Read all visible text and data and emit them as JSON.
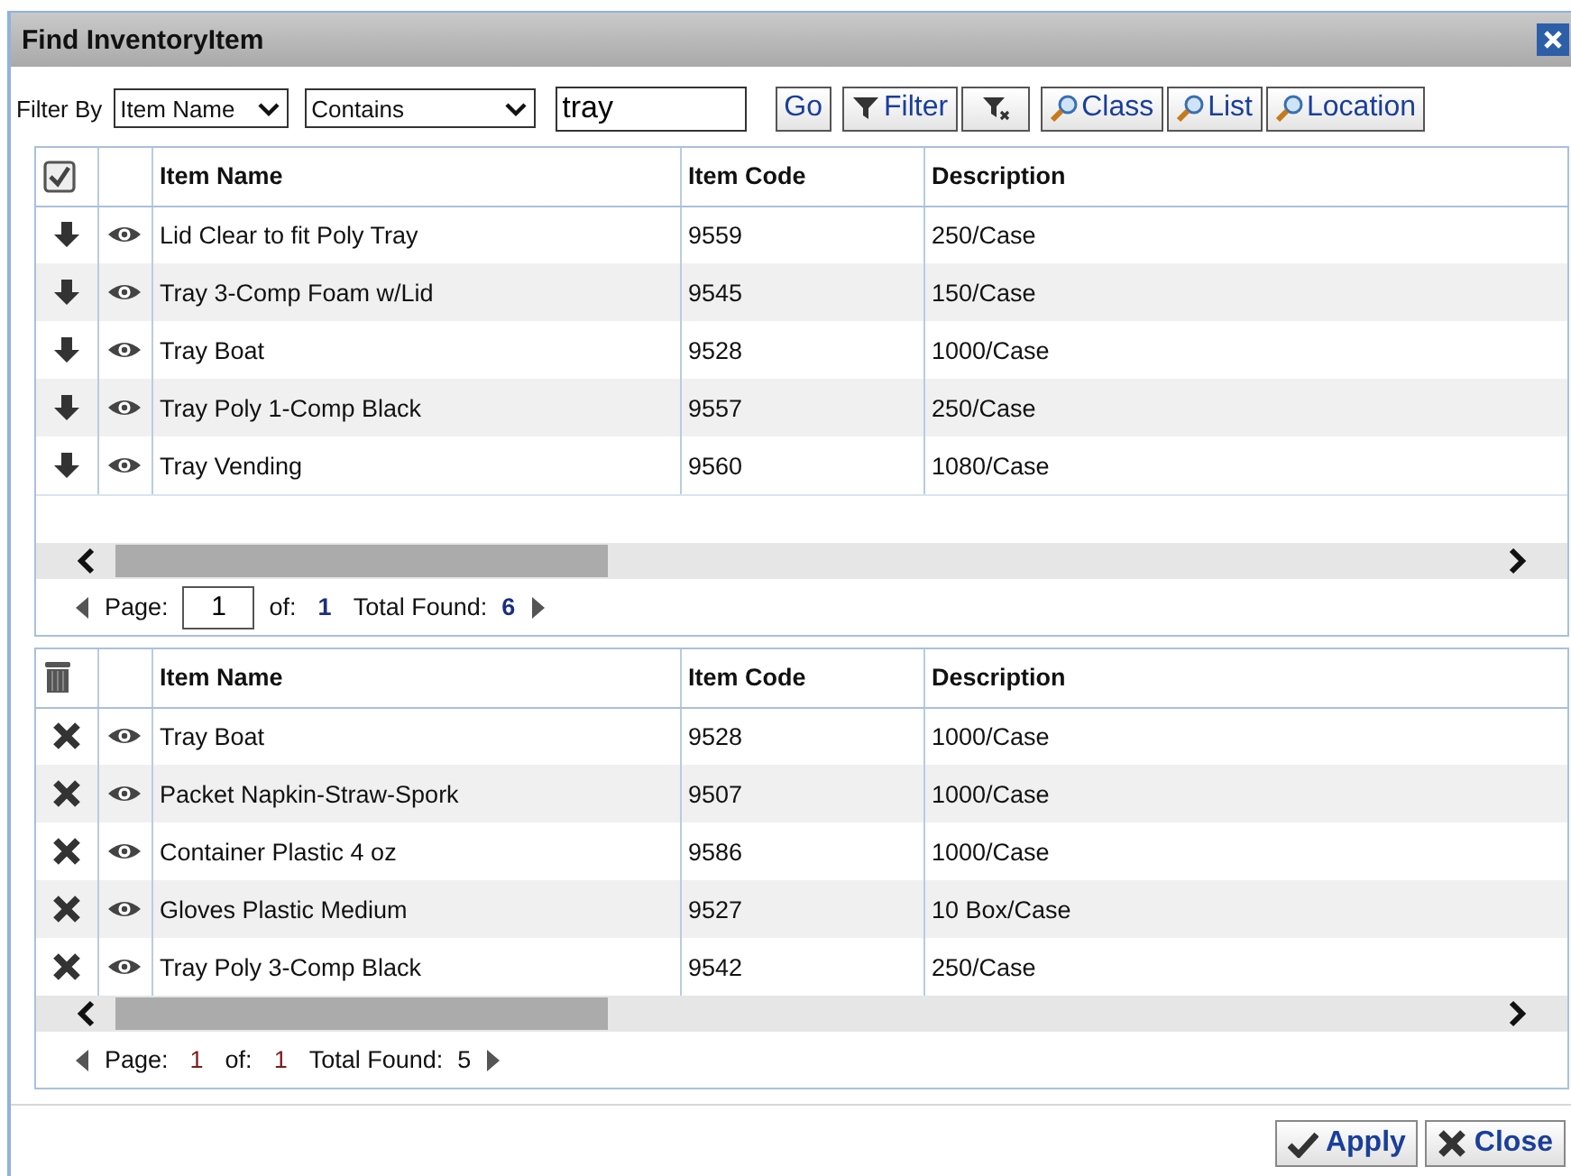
{
  "window": {
    "title": "Find InventoryItem"
  },
  "filter_bar": {
    "label": "Filter By",
    "field_select": "Item Name",
    "operator_select": "Contains",
    "search": {
      "value": "tray"
    },
    "buttons": [
      {
        "label": "Go",
        "kind": "plain"
      },
      {
        "label": "Filter",
        "kind": "filter"
      },
      {
        "kind": "clear"
      },
      {
        "label": "Class",
        "kind": "lookup"
      },
      {
        "label": "List",
        "kind": "lookup"
      },
      {
        "label": "Location",
        "kind": "lookup"
      }
    ]
  },
  "results": {
    "header_checkbox": {
      "checked": true
    },
    "columns": [
      "Item Name",
      "Item Code",
      "Description"
    ],
    "rows": [
      {
        "cells": [
          "Lid Clear to fit Poly Tray",
          "9559",
          "250/Case"
        ]
      },
      {
        "cells": [
          "Tray 3-Comp Foam w/Lid",
          "9545",
          "150/Case"
        ]
      },
      {
        "cells": [
          "Tray Boat",
          "9528",
          "1000/Case"
        ]
      },
      {
        "cells": [
          "Tray Poly 1-Comp Black",
          "9557",
          "250/Case"
        ]
      },
      {
        "cells": [
          "Tray Vending",
          "9560",
          "1080/Case"
        ]
      }
    ],
    "pager": {
      "page_label": "Page:",
      "page": "1",
      "page_editable": true,
      "of_label": "of:",
      "pages": "1",
      "total_label": "Total Found:",
      "total": "6"
    }
  },
  "selected": {
    "columns": [
      "Item Name",
      "Item Code",
      "Description"
    ],
    "rows": [
      {
        "cells": [
          "Tray Boat",
          "9528",
          "1000/Case"
        ]
      },
      {
        "cells": [
          "Packet Napkin-Straw-Spork",
          "9507",
          "1000/Case"
        ]
      },
      {
        "cells": [
          "Container Plastic 4 oz",
          "9586",
          "1000/Case"
        ]
      },
      {
        "cells": [
          "Gloves Plastic Medium",
          "9527",
          "10 Box/Case"
        ]
      },
      {
        "cells": [
          "Tray Poly 3-Comp Black",
          "9542",
          "250/Case"
        ]
      }
    ],
    "pager": {
      "page_label": "Page:",
      "page": "1",
      "page_editable": false,
      "of_label": "of:",
      "pages": "1",
      "total_label": "Total Found:",
      "total": "5"
    }
  },
  "footer_buttons": [
    {
      "label": "Apply",
      "kind": "apply"
    },
    {
      "label": "Close",
      "kind": "close"
    }
  ]
}
